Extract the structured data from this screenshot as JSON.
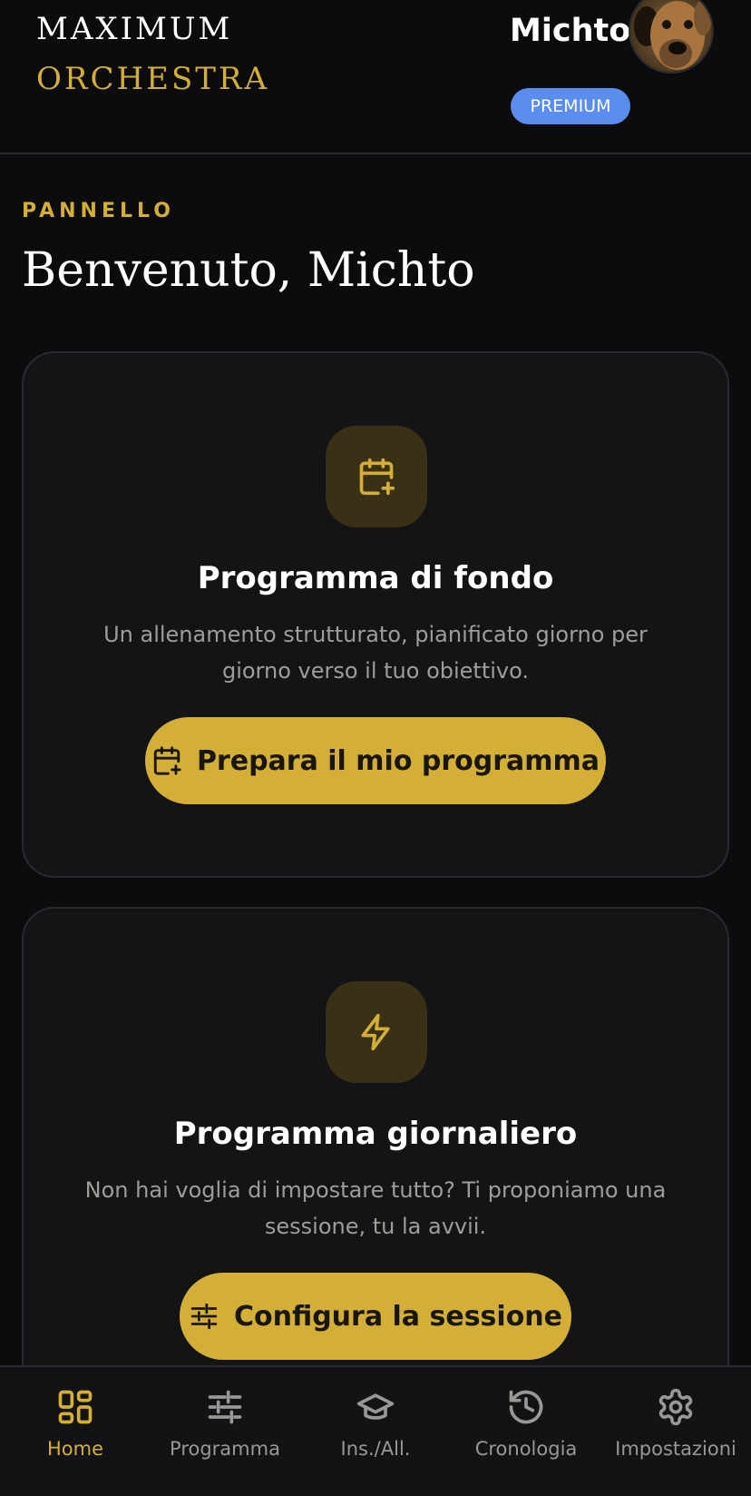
{
  "header": {
    "brand_line1": "MAXIMUM",
    "brand_line2": "ORCHESTRA",
    "user_name": "Michto",
    "badge": "PREMIUM"
  },
  "page": {
    "section_label": "PANNELLO",
    "welcome": "Benvenuto, Michto"
  },
  "cards": [
    {
      "icon": "calendar-plus-icon",
      "title": "Programma di fondo",
      "description": "Un allenamento strutturato, pianificato giorno per giorno verso il tuo obiettivo.",
      "button_icon": "calendar-plus-icon",
      "button_label": "Prepara il mio programma"
    },
    {
      "icon": "lightning-icon",
      "title": "Programma giornaliero",
      "description": "Non hai voglia di impostare tutto? Ti proponiamo una sessione, tu la avvii.",
      "button_icon": "sliders-icon",
      "button_label": "Configura la sessione"
    }
  ],
  "nav": {
    "items": [
      {
        "label": "Home",
        "icon": "grid-icon",
        "active": true
      },
      {
        "label": "Programma",
        "icon": "sliders-icon",
        "active": false
      },
      {
        "label": "Ins./All.",
        "icon": "graduation-cap-icon",
        "active": false
      },
      {
        "label": "Cronologia",
        "icon": "history-icon",
        "active": false
      },
      {
        "label": "Impostazioni",
        "icon": "gear-icon",
        "active": false
      }
    ]
  },
  "colors": {
    "accent": "#d4af37",
    "background": "#0c0c0e",
    "card": "#141417",
    "badge": "#5b8def"
  }
}
